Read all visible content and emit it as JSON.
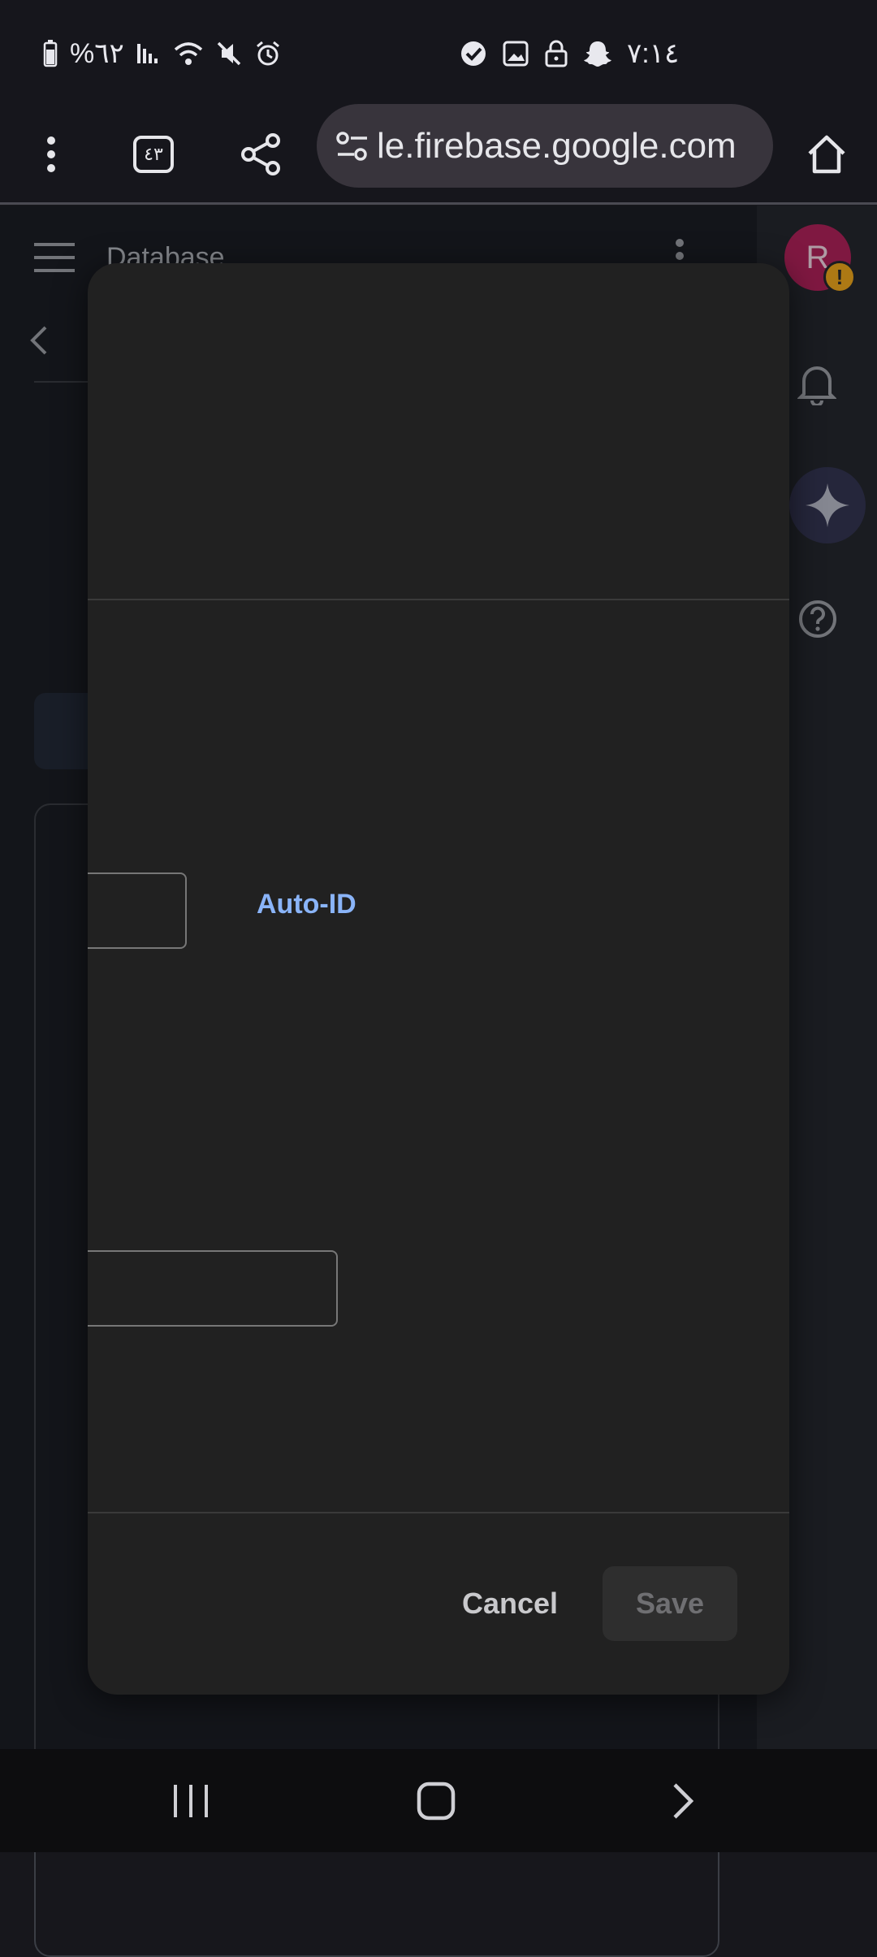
{
  "status_bar": {
    "battery_text": "%٦٢",
    "time": "٧:١٤"
  },
  "browser": {
    "url": "le.firebase.google.com",
    "tab_count": "٤٣"
  },
  "app": {
    "title": "Database",
    "avatar_letter": "R"
  },
  "dialog": {
    "auto_id_label": "Auto-ID",
    "cancel_label": "Cancel",
    "save_label": "Save"
  },
  "colors": {
    "accent": "#8ab4f8",
    "avatar": "#b0225a",
    "warning": "#f0a81d"
  }
}
